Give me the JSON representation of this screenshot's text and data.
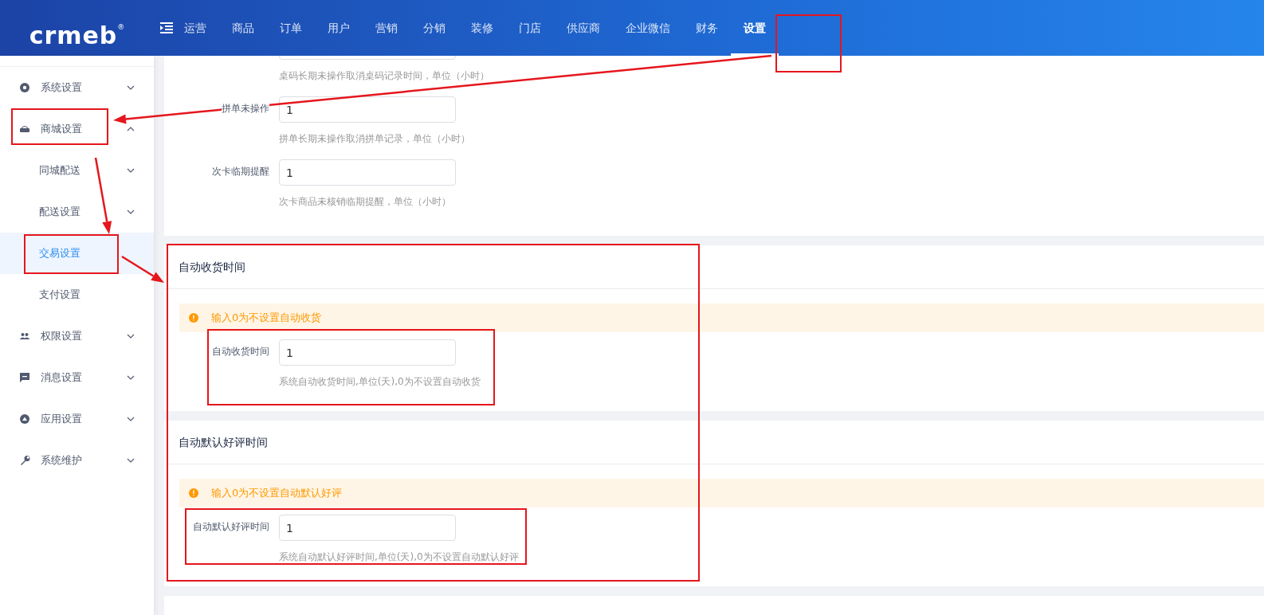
{
  "logo": {
    "text": "crmeb",
    "mark": "®"
  },
  "top_nav": {
    "items": [
      {
        "label": "运营",
        "selected": false
      },
      {
        "label": "商品",
        "selected": false
      },
      {
        "label": "订单",
        "selected": false
      },
      {
        "label": "用户",
        "selected": false
      },
      {
        "label": "营销",
        "selected": false
      },
      {
        "label": "分销",
        "selected": false
      },
      {
        "label": "装修",
        "selected": false
      },
      {
        "label": "门店",
        "selected": false
      },
      {
        "label": "供应商",
        "selected": false
      },
      {
        "label": "企业微信",
        "selected": false
      },
      {
        "label": "财务",
        "selected": false
      },
      {
        "label": "设置",
        "selected": true
      }
    ]
  },
  "sidebar": {
    "items": [
      {
        "label": "系统设置",
        "expanded": false
      },
      {
        "label": "商城设置",
        "expanded": true,
        "children": [
          {
            "label": "同城配送",
            "kind": "group",
            "expanded": false,
            "selected": false
          },
          {
            "label": "配送设置",
            "kind": "group",
            "expanded": false,
            "selected": false
          },
          {
            "label": "交易设置",
            "kind": "leaf",
            "selected": true
          },
          {
            "label": "支付设置",
            "kind": "leaf",
            "selected": false
          }
        ]
      },
      {
        "label": "权限设置",
        "expanded": false
      },
      {
        "label": "消息设置",
        "expanded": false
      },
      {
        "label": "应用设置",
        "expanded": false
      },
      {
        "label": "系统维护",
        "expanded": false
      }
    ]
  },
  "sections": [
    {
      "fields": [
        {
          "hint": "桌码长期未操作取消桌码记录时间，单位（小时）"
        },
        {
          "label": "拼单未操作",
          "value": "1",
          "hint": "拼单长期未操作取消拼单记录，单位（小时）"
        },
        {
          "label": "次卡临期提醒",
          "value": "1",
          "hint": "次卡商品未核销临期提醒，单位（小时）"
        }
      ]
    },
    {
      "title": "自动收货时间",
      "alert": "输入0为不设置自动收货",
      "fields": [
        {
          "label": "自动收货时间",
          "value": "1",
          "hint": "系统自动收货时间,单位(天),0为不设置自动收货"
        }
      ]
    },
    {
      "title": "自动默认好评时间",
      "alert": "输入0为不设置自动默认好评",
      "fields": [
        {
          "label": "自动默认好评时间",
          "value": "1",
          "hint": "系统自动默认好评时间,单位(天),0为不设置自动默认好评"
        }
      ]
    }
  ]
}
